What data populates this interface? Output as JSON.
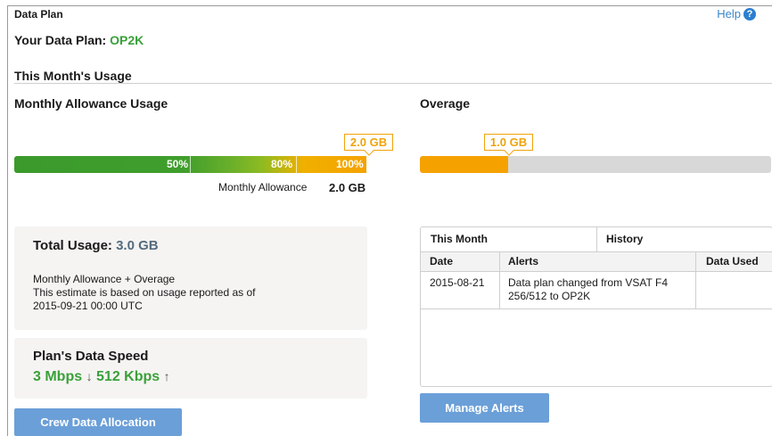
{
  "header": {
    "title": "Data Plan",
    "help_label": "Help",
    "help_icon": "question-circle-icon"
  },
  "plan": {
    "prefix": "Your Data Plan:",
    "name": "OP2K"
  },
  "section_title": "This Month's Usage",
  "allowance": {
    "title": "Monthly Allowance Usage",
    "callout": "2.0 GB",
    "markers": [
      "50%",
      "80%",
      "100%"
    ],
    "caption": "Monthly Allowance",
    "amount": "2.0 GB",
    "fill_fraction": 1.0
  },
  "overage": {
    "title": "Overage",
    "callout": "1.0 GB",
    "fill_fraction": 0.25
  },
  "total_usage": {
    "label": "Total Usage:",
    "amount": "3.0 GB",
    "line1": "Monthly Allowance + Overage",
    "line2": "This estimate is based on usage reported as of",
    "line3": "2015-09-21 00:00 UTC"
  },
  "speed": {
    "title": "Plan's Data Speed",
    "down": "3 Mbps",
    "down_arrow": "↓",
    "up": "512 Kbps",
    "up_arrow": "↑"
  },
  "buttons": {
    "crew": "Crew Data Allocation",
    "manage_alerts": "Manage Alerts"
  },
  "alerts": {
    "tabs": [
      "This Month",
      "History"
    ],
    "columns": [
      "Date",
      "Alerts",
      "Data Used"
    ],
    "rows": [
      {
        "date": "2015-08-21",
        "alert": "Data plan changed from VSAT F4 256/512 to OP2K",
        "data_used": ""
      }
    ]
  },
  "colors": {
    "green": "#3aa03a",
    "orange": "#f5a200",
    "button_blue": "#6b9fd8",
    "link_blue": "#3a87c9"
  }
}
